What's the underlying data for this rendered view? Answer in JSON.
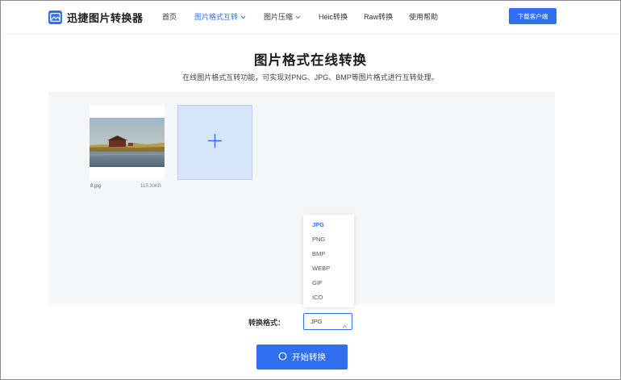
{
  "header": {
    "brand": "迅捷图片转换器",
    "nav": [
      {
        "label": "首页",
        "active": false,
        "has_dropdown": false
      },
      {
        "label": "图片格式互转",
        "active": true,
        "has_dropdown": true
      },
      {
        "label": "图片压缩",
        "active": false,
        "has_dropdown": true
      },
      {
        "label": "Heic转换",
        "active": false,
        "has_dropdown": false
      },
      {
        "label": "Raw转换",
        "active": false,
        "has_dropdown": false
      },
      {
        "label": "使用帮助",
        "active": false,
        "has_dropdown": false
      }
    ],
    "download_label": "下载客户端"
  },
  "main": {
    "title": "图片格式在线转换",
    "subtitle": "在线图片格式互转功能，可实现对PNG、JPG、BMP等图片格式进行互转处理。"
  },
  "file": {
    "name": "8.jpg",
    "size": "115.30KB"
  },
  "dropdown": {
    "options": [
      "JPG",
      "PNG",
      "BMP",
      "WEBP",
      "GIF",
      "ICO"
    ],
    "selected": "JPG"
  },
  "format": {
    "label": "转换格式：",
    "value": "JPG"
  },
  "start_label": "开始转换",
  "colors": {
    "accent": "#2f6ff0",
    "work_area_bg": "#f4f6f8",
    "add_tile_bg": "#d7e5fb"
  },
  "icons": {
    "logo": "image-logo-icon",
    "add": "plus-icon",
    "start": "ring-icon",
    "select_arrow": "chevron-up-icon"
  }
}
